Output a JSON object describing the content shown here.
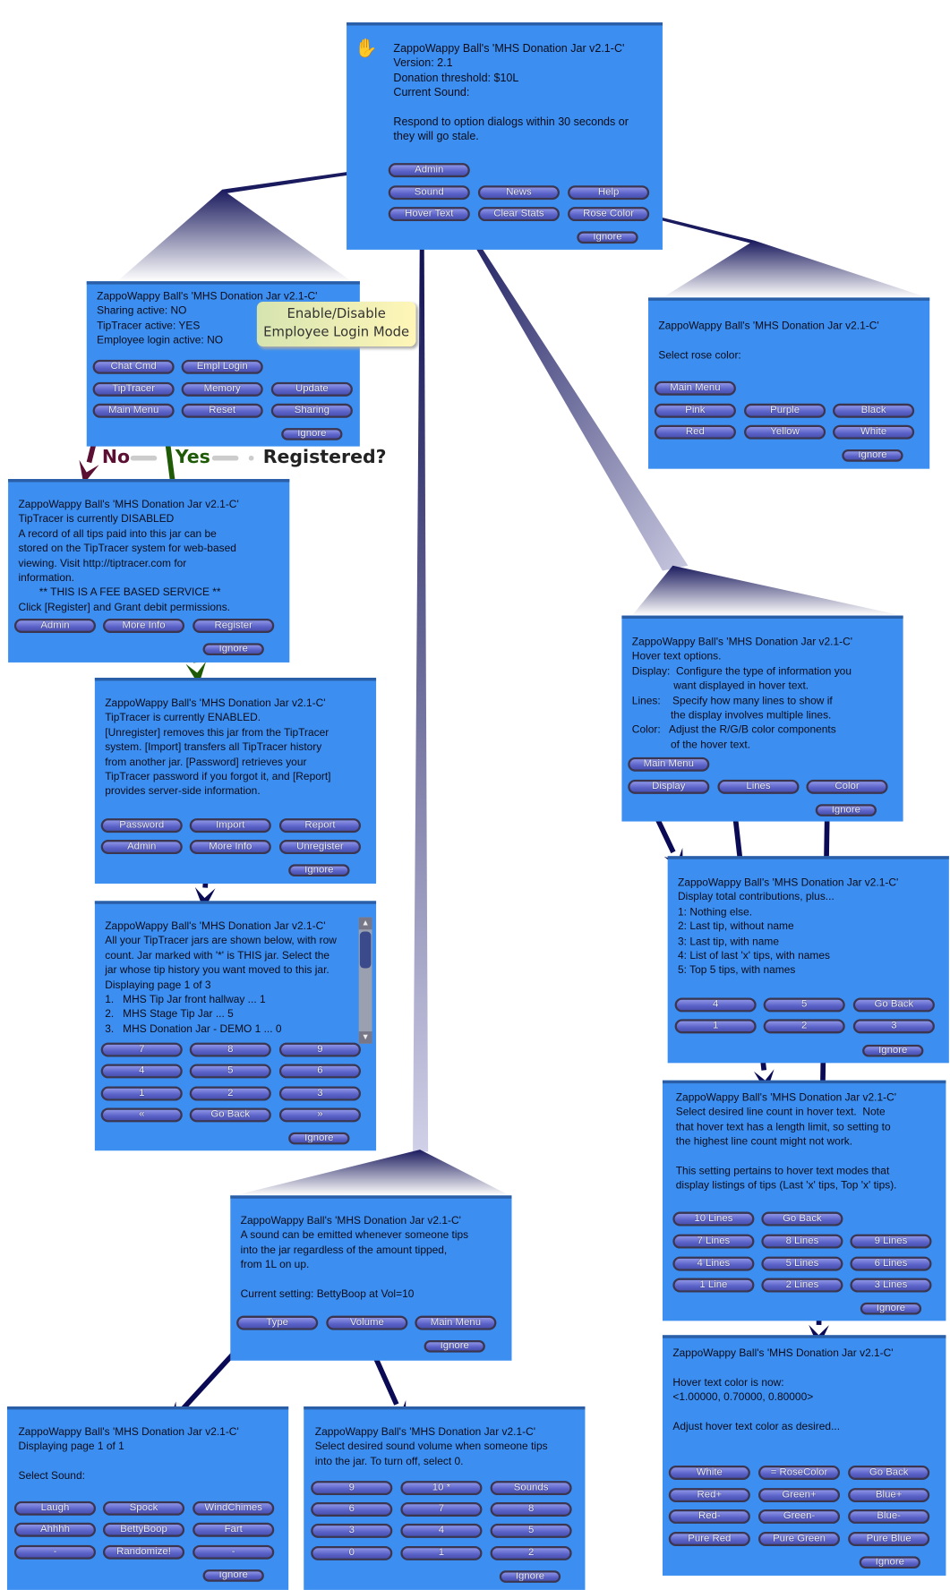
{
  "colors": {
    "panel": "#3c8ff0",
    "button": "#5a62c8",
    "arrow_no": "#5a0f33",
    "arrow_yes": "#1f5a06",
    "arrow_nav": "#0a0a55",
    "tooltip": "#fff6b8"
  },
  "labels": {
    "no": "No",
    "yes": "Yes",
    "registered": "Registered?"
  },
  "tooltip": {
    "line1": "Enable/Disable",
    "line2": "Employee Login Mode"
  },
  "panels": [
    {
      "id": "main-menu",
      "icon": "hand-help-icon",
      "lines": [
        "ZappoWappy Ball's 'MHS Donation Jar v2.1-C'",
        "Version: 2.1",
        "Donation threshold: $10L",
        "Current Sound:",
        "",
        "Respond to option dialogs within 30 seconds or",
        "they will go stale."
      ],
      "buttons": [
        "Admin",
        "Sound",
        "News",
        "Help",
        "Hover Text",
        "Clear Stats",
        "Rose Color",
        "Ignore"
      ]
    },
    {
      "id": "admin-menu",
      "lines": [
        "ZappoWappy Ball's 'MHS Donation Jar v2.1-C'",
        "Sharing active: NO",
        "TipTracer active: YES",
        "Employee login active: NO"
      ],
      "buttons": [
        "Chat Cmd",
        "Empl Login",
        "TipTracer",
        "Memory",
        "Update",
        "Main Menu",
        "Reset",
        "Sharing",
        "Ignore"
      ]
    },
    {
      "id": "tiptracer-disabled",
      "lines": [
        "ZappoWappy Ball's 'MHS Donation Jar v2.1-C'",
        "TipTracer is currently DISABLED",
        "A record of all tips paid into this jar can be",
        "stored on the TipTracer system for web-based",
        "viewing. Visit http://tiptracer.com for",
        "information.",
        "       ** THIS IS A FEE BASED SERVICE **",
        "Click [Register] and Grant debit permissions."
      ],
      "buttons": [
        "Admin",
        "More Info",
        "Register",
        "Ignore"
      ]
    },
    {
      "id": "tiptracer-enabled",
      "lines": [
        "ZappoWappy Ball's 'MHS Donation Jar v2.1-C'",
        "TipTracer is currently ENABLED.",
        "[Unregister] removes this jar from the TipTracer",
        "system. [Import] transfers all TipTracer history",
        "from another jar. [Password] retrieves your",
        "TipTracer password if you forgot it, and [Report]",
        "provides server-side information."
      ],
      "buttons": [
        "Password",
        "Import",
        "Report",
        "Admin",
        "More Info",
        "Unregister",
        "Ignore"
      ]
    },
    {
      "id": "tiptracer-import",
      "lines": [
        "ZappoWappy Ball's 'MHS Donation Jar v2.1-C'",
        "All your TipTracer jars are shown below, with row",
        "count. Jar marked with '*' is THIS jar. Select the",
        "jar whose tip history you want moved to this jar.",
        "Displaying page 1 of 3",
        "1.   MHS Tip Jar front hallway ... 1",
        "2.   MHS Stage Tip Jar ... 5",
        "3.   MHS Donation Jar - DEMO 1 ... 0"
      ],
      "buttons": [
        "7",
        "8",
        "9",
        "4",
        "5",
        "6",
        "1",
        "2",
        "3",
        "«",
        "Go Back",
        "»",
        "Ignore"
      ]
    },
    {
      "id": "rose-color",
      "lines": [
        "ZappoWappy Ball's 'MHS Donation Jar v2.1-C'",
        "",
        "Select rose color:"
      ],
      "buttons": [
        "Main Menu",
        "Pink",
        "Purple",
        "Black",
        "Red",
        "Yellow",
        "White",
        "Ignore"
      ]
    },
    {
      "id": "hover-text",
      "lines": [
        "ZappoWappy Ball's 'MHS Donation Jar v2.1-C'",
        "Hover text options.",
        "Display:  Configure the type of information you",
        "              want displayed in hover text.",
        "Lines:    Specify how many lines to show if",
        "             the display involves multiple lines.",
        "Color:   Adjust the R/G/B color components",
        "             of the hover text."
      ],
      "buttons": [
        "Main Menu",
        "Display",
        "Lines",
        "Color",
        "Ignore"
      ]
    },
    {
      "id": "hover-display",
      "lines": [
        "ZappoWappy Ball's 'MHS Donation Jar v2.1-C'",
        "Display total contributions, plus...",
        "1: Nothing else.",
        "2: Last tip, without name",
        "3: Last tip, with name",
        "4: List of last 'x' tips, with names",
        "5: Top 5 tips, with names"
      ],
      "buttons": [
        "4",
        "5",
        "Go Back",
        "1",
        "2",
        "3",
        "Ignore"
      ]
    },
    {
      "id": "hover-lines",
      "lines": [
        "ZappoWappy Ball's 'MHS Donation Jar v2.1-C'",
        "Select desired line count in hover text.  Note",
        "that hover text has a length limit, so setting to",
        "the highest line count might not work.",
        "",
        "This setting pertains to hover text modes that",
        "display listings of tips (Last 'x' tips, Top 'x' tips)."
      ],
      "buttons": [
        "10 Lines",
        "Go Back",
        "7 Lines",
        "8 Lines",
        "9 Lines",
        "4 Lines",
        "5 Lines",
        "6 Lines",
        "1 Line",
        "2 Lines",
        "3 Lines",
        "Ignore"
      ]
    },
    {
      "id": "hover-color",
      "lines": [
        "ZappoWappy Ball's 'MHS Donation Jar v2.1-C'",
        "",
        "Hover text color is now:",
        "<1.00000, 0.70000, 0.80000>",
        "",
        "Adjust hover text color as desired..."
      ],
      "buttons": [
        "White",
        "= RoseColor",
        "Go Back",
        "Red+",
        "Green+",
        "Blue+",
        "Red-",
        "Green-",
        "Blue-",
        "Pure Red",
        "Pure Green",
        "Pure Blue",
        "Ignore"
      ]
    },
    {
      "id": "sound-menu",
      "lines": [
        "ZappoWappy Ball's 'MHS Donation Jar v2.1-C'",
        "A sound can be emitted whenever someone tips",
        "into the jar regardless of the amount tipped,",
        "from 1L on up.",
        "",
        "Current setting: BettyBoop at Vol=10"
      ],
      "buttons": [
        "Type",
        "Volume",
        "Main Menu",
        "Ignore"
      ]
    },
    {
      "id": "sound-type",
      "lines": [
        "ZappoWappy Ball's 'MHS Donation Jar v2.1-C'",
        "Displaying page 1 of 1",
        "",
        "Select Sound:"
      ],
      "buttons": [
        "Laugh",
        "Spock",
        "WindChimes",
        "Ahhhh",
        "BettyBoop",
        "Fart",
        "-",
        "Randomize!",
        "-",
        "Ignore"
      ]
    },
    {
      "id": "sound-volume",
      "lines": [
        "ZappoWappy Ball's 'MHS Donation Jar v2.1-C'",
        "Select desired sound volume when someone tips",
        "into the jar. To turn off, select 0."
      ],
      "buttons": [
        "9",
        "10 *",
        "Sounds",
        "6",
        "7",
        "8",
        "3",
        "4",
        "5",
        "0",
        "1",
        "2",
        "Ignore"
      ]
    }
  ]
}
